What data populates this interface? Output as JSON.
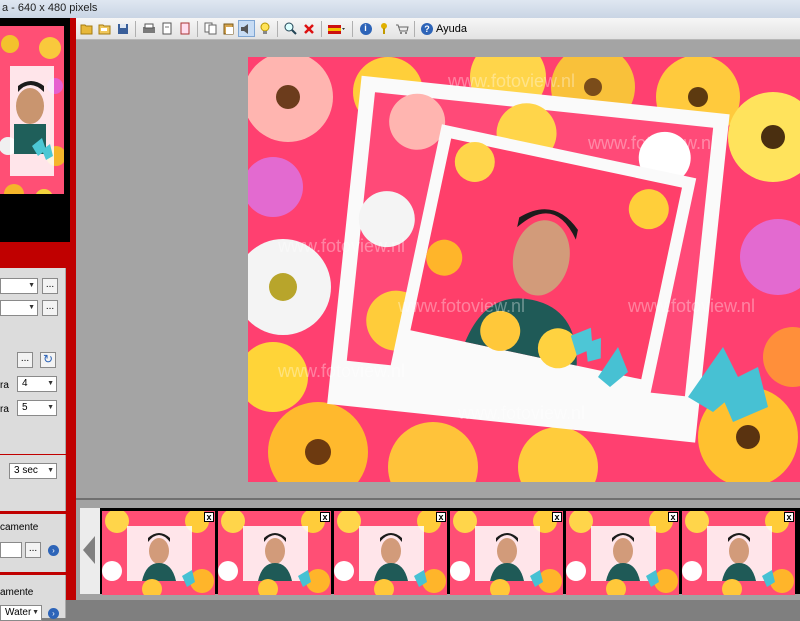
{
  "window": {
    "title": "a - 640 x 480 pixels"
  },
  "toolbar": {
    "icons": [
      "folder-open-icon",
      "folder-icon",
      "save-icon",
      "print-icon",
      "page-icon",
      "slideshow-icon",
      "copy-icon",
      "paste-icon",
      "speaker-icon",
      "bulb-icon",
      "search-icon",
      "delete-icon",
      "flag-icon",
      "info-icon",
      "key-icon",
      "cart-icon"
    ],
    "help_label": "Ayuda"
  },
  "left_panel": {
    "combo_4": "4",
    "combo_5": "5",
    "label_ra_1": "ra",
    "label_ra_2": "ra",
    "timer_value": "3 sec",
    "label_automatic_1": "camente",
    "label_automatic_2": "amente",
    "combo_water": "Water"
  },
  "canvas": {
    "watermark": "www.fotoview.nl",
    "background_color": "#a4a4a4",
    "photo_bg": "#ff3f6a"
  },
  "filmstrip": {
    "thumbnail_count": 6,
    "close_label": "x"
  }
}
